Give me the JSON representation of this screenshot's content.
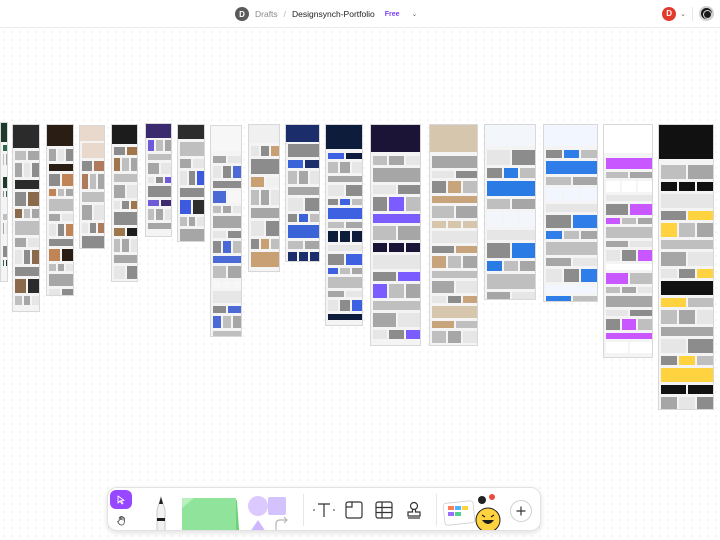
{
  "topbar": {
    "workspace_initial": "D",
    "breadcrumb_root": "Drafts",
    "separator": "/",
    "file_name": "Designsynch-Portfolio",
    "plan_badge": "Free",
    "user_initial": "D"
  },
  "toolbar": {
    "tools": [
      {
        "name": "move-tool",
        "icon": "cursor-arrow-icon",
        "active": true
      },
      {
        "name": "hand-tool",
        "icon": "hand-icon",
        "active": false
      },
      {
        "name": "marker-tool",
        "icon": "marker-pen-icon"
      },
      {
        "name": "sticky-note-tool",
        "icon": "sticky-note-icon"
      },
      {
        "name": "shapes-tool",
        "icon": "shapes-icon"
      },
      {
        "name": "text-tool",
        "icon": "text-icon"
      },
      {
        "name": "section-tool",
        "icon": "section-icon"
      },
      {
        "name": "table-tool",
        "icon": "table-icon"
      },
      {
        "name": "stamp-tool",
        "icon": "stamp-icon"
      },
      {
        "name": "widgets-tool",
        "icon": "widgets-icon"
      },
      {
        "name": "add-more",
        "icon": "plus-icon"
      }
    ],
    "text_glyph": "T"
  },
  "colors": {
    "accent": "#9747ff",
    "free_badge": "#7b3ff2",
    "user_avatar": "#e23b2e",
    "sticky_note": "#7fd88a",
    "shape_fill": "#d8c4ff"
  }
}
